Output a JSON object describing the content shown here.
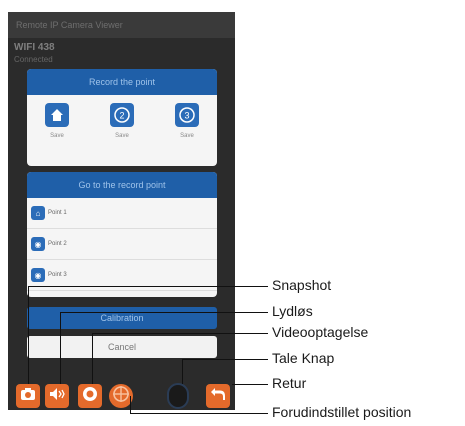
{
  "background": {
    "status_bar": "Remote IP Camera Viewer",
    "device_name": "WIFI 438",
    "device_sub": "Connected"
  },
  "record_panel": {
    "title": "Record the point",
    "slots": [
      {
        "icon": "house-icon",
        "label": "Save"
      },
      {
        "icon": "number-2-icon",
        "label": "Save"
      },
      {
        "icon": "number-3-icon",
        "label": "Save"
      }
    ]
  },
  "goto_panel": {
    "title": "Go to the record point",
    "points": [
      "Point 1",
      "Point 2",
      "Point 3"
    ]
  },
  "calibration_label": "Calibration",
  "cancel_label": "Cancel",
  "callouts": {
    "snapshot": "Snapshot",
    "mute": "Lydløs",
    "video": "Videooptagelse",
    "talk": "Tale Knap",
    "back": "Retur",
    "preset": "Forudindstillet position"
  },
  "colors": {
    "accent_orange": "#e46a2b",
    "panel_blue": "#1f5fa8"
  }
}
